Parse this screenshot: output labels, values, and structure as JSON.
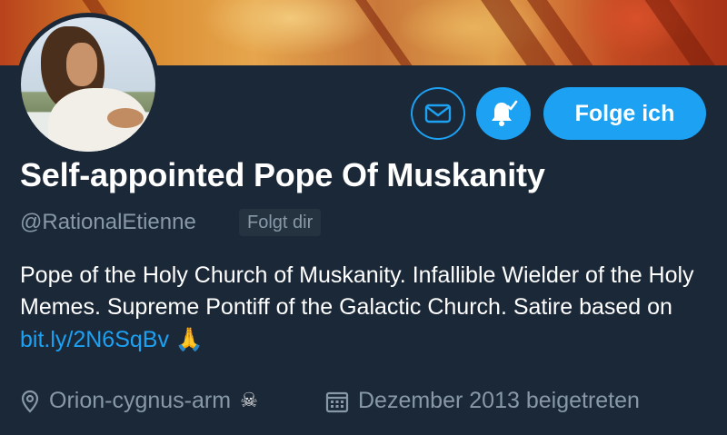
{
  "profile": {
    "display_name": "Self-appointed Pope Of Muskanity",
    "handle": "@RationalEtienne",
    "follows_you_badge": "Folgt dir",
    "bio": {
      "text_before_link": "Pope of the Holy Church of Muskanity. Infallible Wielder of the Holy Memes. Supreme Pontiff of the Galactic Church. Satire based on ",
      "link_text": "bit.ly/2N6SqBv",
      "emoji": "🙏"
    },
    "location": "Orion-cygnus-arm",
    "location_emoji": "☠",
    "joined": "Dezember 2013 beigetreten"
  },
  "actions": {
    "message_icon": "mail-icon",
    "notifications_icon": "bell-icon",
    "follow_label": "Folge ich"
  },
  "colors": {
    "background": "#1b2838",
    "accent": "#1da1f2",
    "secondary_text": "#8899a6"
  }
}
